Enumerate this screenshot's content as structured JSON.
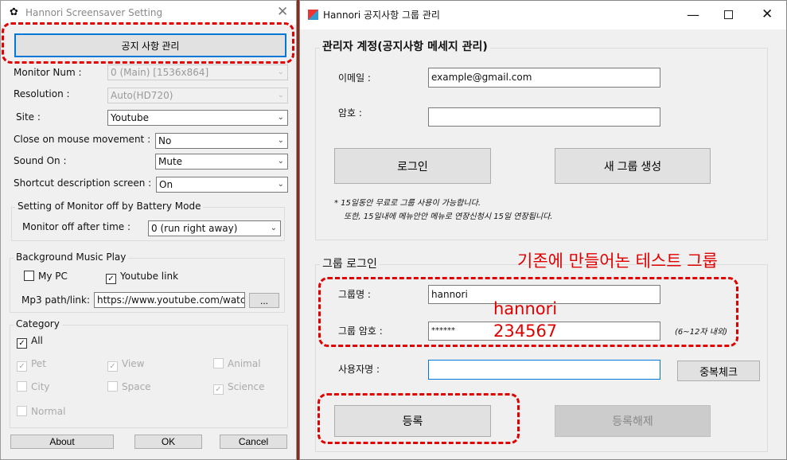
{
  "left": {
    "title": "Hannori Screensaver Setting",
    "notice_button": "공지 사항 관리",
    "monitor_num": {
      "label": "Monitor Num :",
      "value": "0 (Main) [1536x864]"
    },
    "resolution": {
      "label": "Resolution :",
      "value": "Auto(HD720)"
    },
    "site": {
      "label": "Site :",
      "value": "Youtube"
    },
    "close_mouse": {
      "label": "Close on mouse movement :",
      "value": "No"
    },
    "sound": {
      "label": "Sound On :",
      "value": "Mute"
    },
    "shortcut": {
      "label": "Shortcut description screen :",
      "value": "On"
    },
    "battery": {
      "group": "Setting of Monitor off by Battery Mode",
      "label": "Monitor off after time :",
      "value": "0 (run right away)"
    },
    "music": {
      "group": "Background Music Play",
      "my_pc": "My PC",
      "my_pc_checked": false,
      "youtube": "Youtube link",
      "youtube_checked": true,
      "path_label": "Mp3 path/link:",
      "path_value": "https://www.youtube.com/watc",
      "browse": "..."
    },
    "category": {
      "group": "Category",
      "all": "All",
      "all_checked": true,
      "items": [
        {
          "label": "Pet",
          "checked": true
        },
        {
          "label": "View",
          "checked": true
        },
        {
          "label": "Animal",
          "checked": false
        },
        {
          "label": "City",
          "checked": false
        },
        {
          "label": "Space",
          "checked": false
        },
        {
          "label": "Science",
          "checked": true
        },
        {
          "label": "Normal",
          "checked": false
        }
      ]
    },
    "about": "About",
    "ok": "OK",
    "cancel": "Cancel"
  },
  "right": {
    "title": "Hannori 공지사항 그룹 관리",
    "admin": {
      "group": "관리자 계정(공지사항 메세지 관리)",
      "email_label": "이메일 :",
      "email_value": "example@gmail.com",
      "password_label": "암호 :",
      "password_value": "",
      "login": "로그인",
      "new_group": "새 그룹 생성",
      "note1": "* 15일동안 무료로 그룹 사용이 가능합니다.",
      "note2": "또한, 15일내에 메뉴안안 메뉴로 연장신청시 15일 연장됩니다."
    },
    "group_login": {
      "group": "그룹 로그인",
      "name_label": "그룹명 :",
      "name_value": "hannori",
      "pw_label": "그룹 암호 :",
      "pw_value": "******",
      "pw_hint": "(6~12자 내외)",
      "user_label": "사용자명 :",
      "user_value": "",
      "dup_check": "중복체크",
      "register": "등록",
      "unregister": "등록해제"
    }
  },
  "annotations": {
    "existing_group": "기존에 만들어논 테스트 그룹",
    "name": "hannori",
    "password": "234567",
    "color": "#e00000"
  }
}
